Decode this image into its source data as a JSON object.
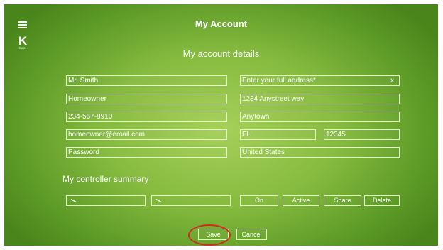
{
  "header": {
    "title": "My Account"
  },
  "logo": {
    "letter": "K",
    "subtext": "RAIN"
  },
  "subtitle": "My account details",
  "left_fields": [
    "Mr. Smith",
    "Homeowner",
    "234-567-8910",
    "homeowner@email.com",
    "Password"
  ],
  "address": {
    "placeholder": "Enter your full address*",
    "clear": "x",
    "street": "1234 Anystreet way",
    "city": "Anytown",
    "state": "FL",
    "zip": "12345",
    "country": "United States"
  },
  "controller": {
    "title": "My controller summary",
    "on": "On",
    "active": "Active",
    "share": "Share",
    "delete": "Delete"
  },
  "actions": {
    "save": "Save",
    "cancel": "Cancel"
  },
  "colors": {
    "highlight_circle": "#d42a20"
  }
}
